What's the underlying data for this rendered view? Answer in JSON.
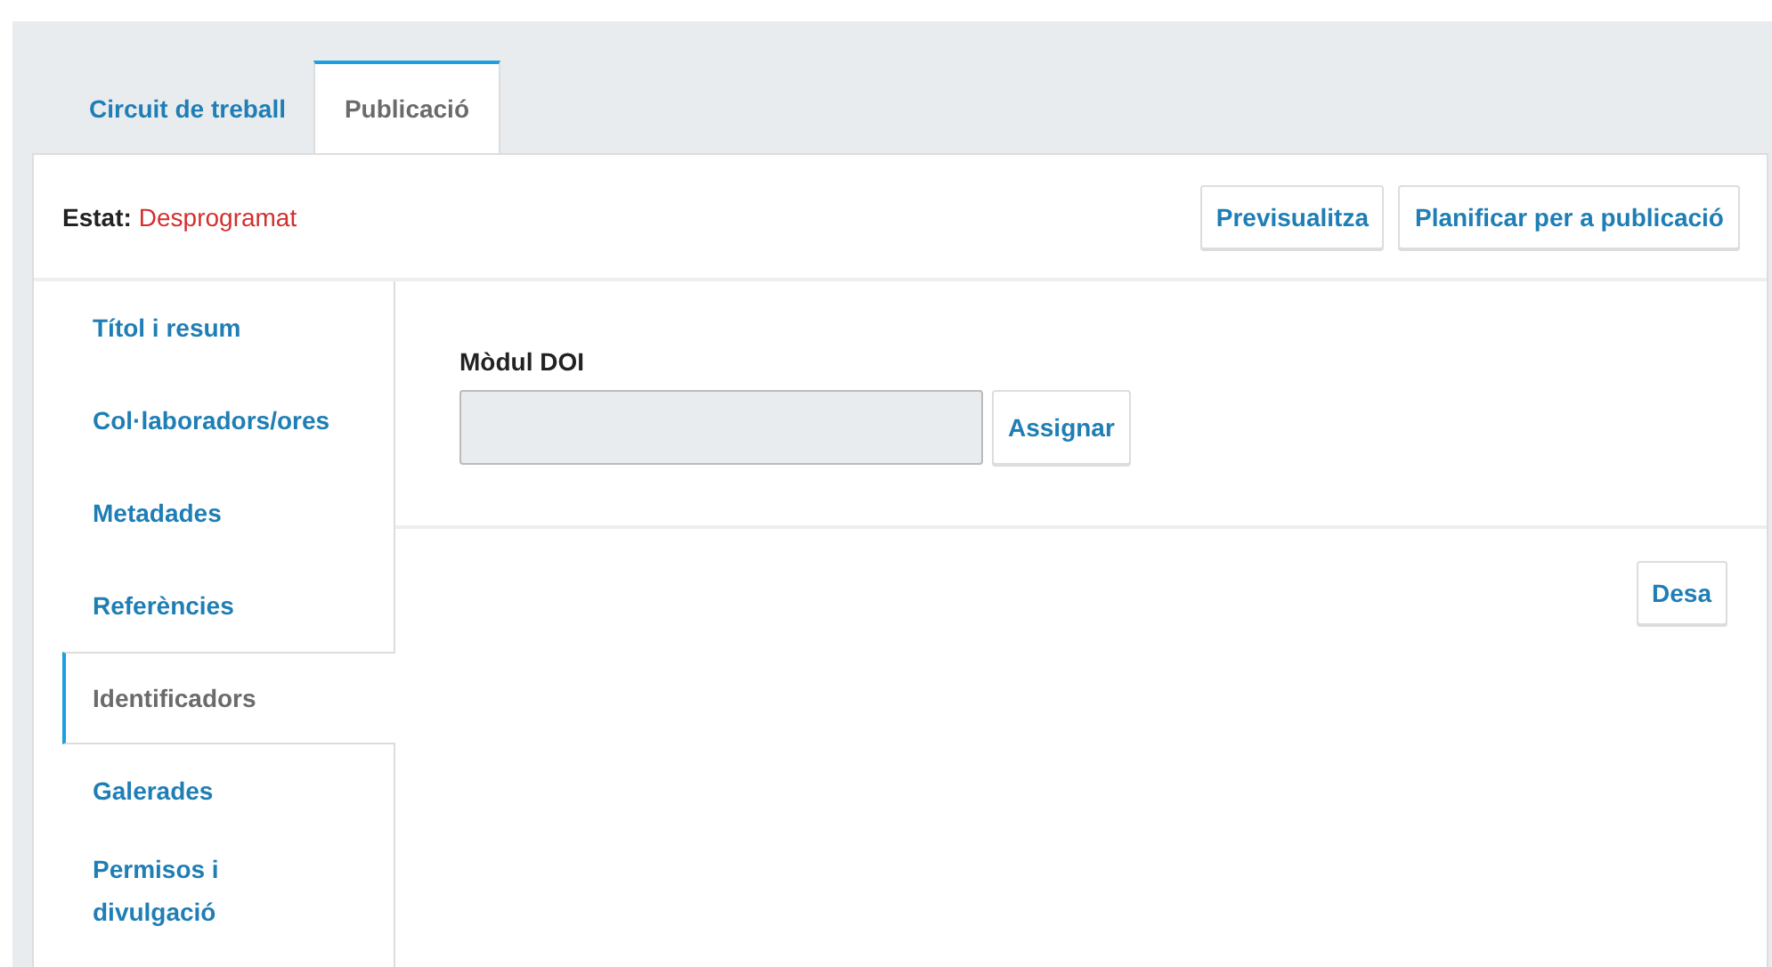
{
  "tabs": [
    {
      "label": "Circuit de treball",
      "selected": false
    },
    {
      "label": "Publicació",
      "selected": true
    }
  ],
  "status": {
    "label": "Estat:",
    "value": "Desprogramat"
  },
  "header_buttons": [
    "Previsualitza",
    "Planificar per a publicació"
  ],
  "sidebar": {
    "items": [
      {
        "label": "Títol i resum",
        "selected": false
      },
      {
        "label": "Col·laboradors/ores",
        "selected": false
      },
      {
        "label": "Metadades",
        "selected": false
      },
      {
        "label": "Referències",
        "selected": false
      },
      {
        "label": "Identificadors",
        "selected": true
      },
      {
        "label": "Galerades",
        "selected": false
      },
      {
        "label": "Permisos i divulgació",
        "selected": false
      }
    ]
  },
  "form": {
    "field": {
      "label": "Mòdul DOI",
      "disabled": true
    },
    "assign_button": "Assignar"
  },
  "save_button": "Desa"
}
